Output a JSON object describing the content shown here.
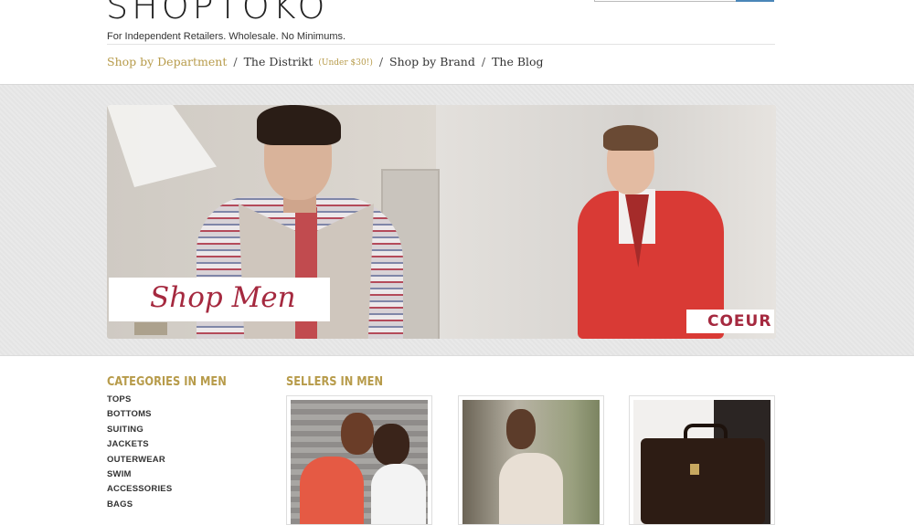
{
  "header": {
    "logo_text": "SHOPTOKO",
    "tagline": "For Independent Retailers. Wholesale. No Minimums."
  },
  "nav": {
    "items": [
      {
        "label": "Shop by Department",
        "active": true
      },
      {
        "label": "The Distrikt",
        "sub": "(Under $30!)"
      },
      {
        "label": "Shop by Brand"
      },
      {
        "label": "The Blog"
      }
    ],
    "separator": "/"
  },
  "hero": {
    "cta": "Shop Men",
    "brand": "COEUR"
  },
  "categories": {
    "title": "CATEGORIES IN MEN",
    "items": [
      "TOPS",
      "BOTTOMS",
      "SUITING",
      "JACKETS",
      "OUTERWEAR",
      "SWIM",
      "ACCESSORIES",
      "BAGS"
    ]
  },
  "sellers": {
    "title": "SELLERS IN MEN",
    "cards": [
      {
        "image": "couple-photo"
      },
      {
        "image": "woman-dress-photo"
      },
      {
        "image": "leather-bag-photo"
      }
    ]
  },
  "colors": {
    "accent_gold": "#b79b4a",
    "brand_red": "#a5293f",
    "search_button": "#4a86b8"
  }
}
